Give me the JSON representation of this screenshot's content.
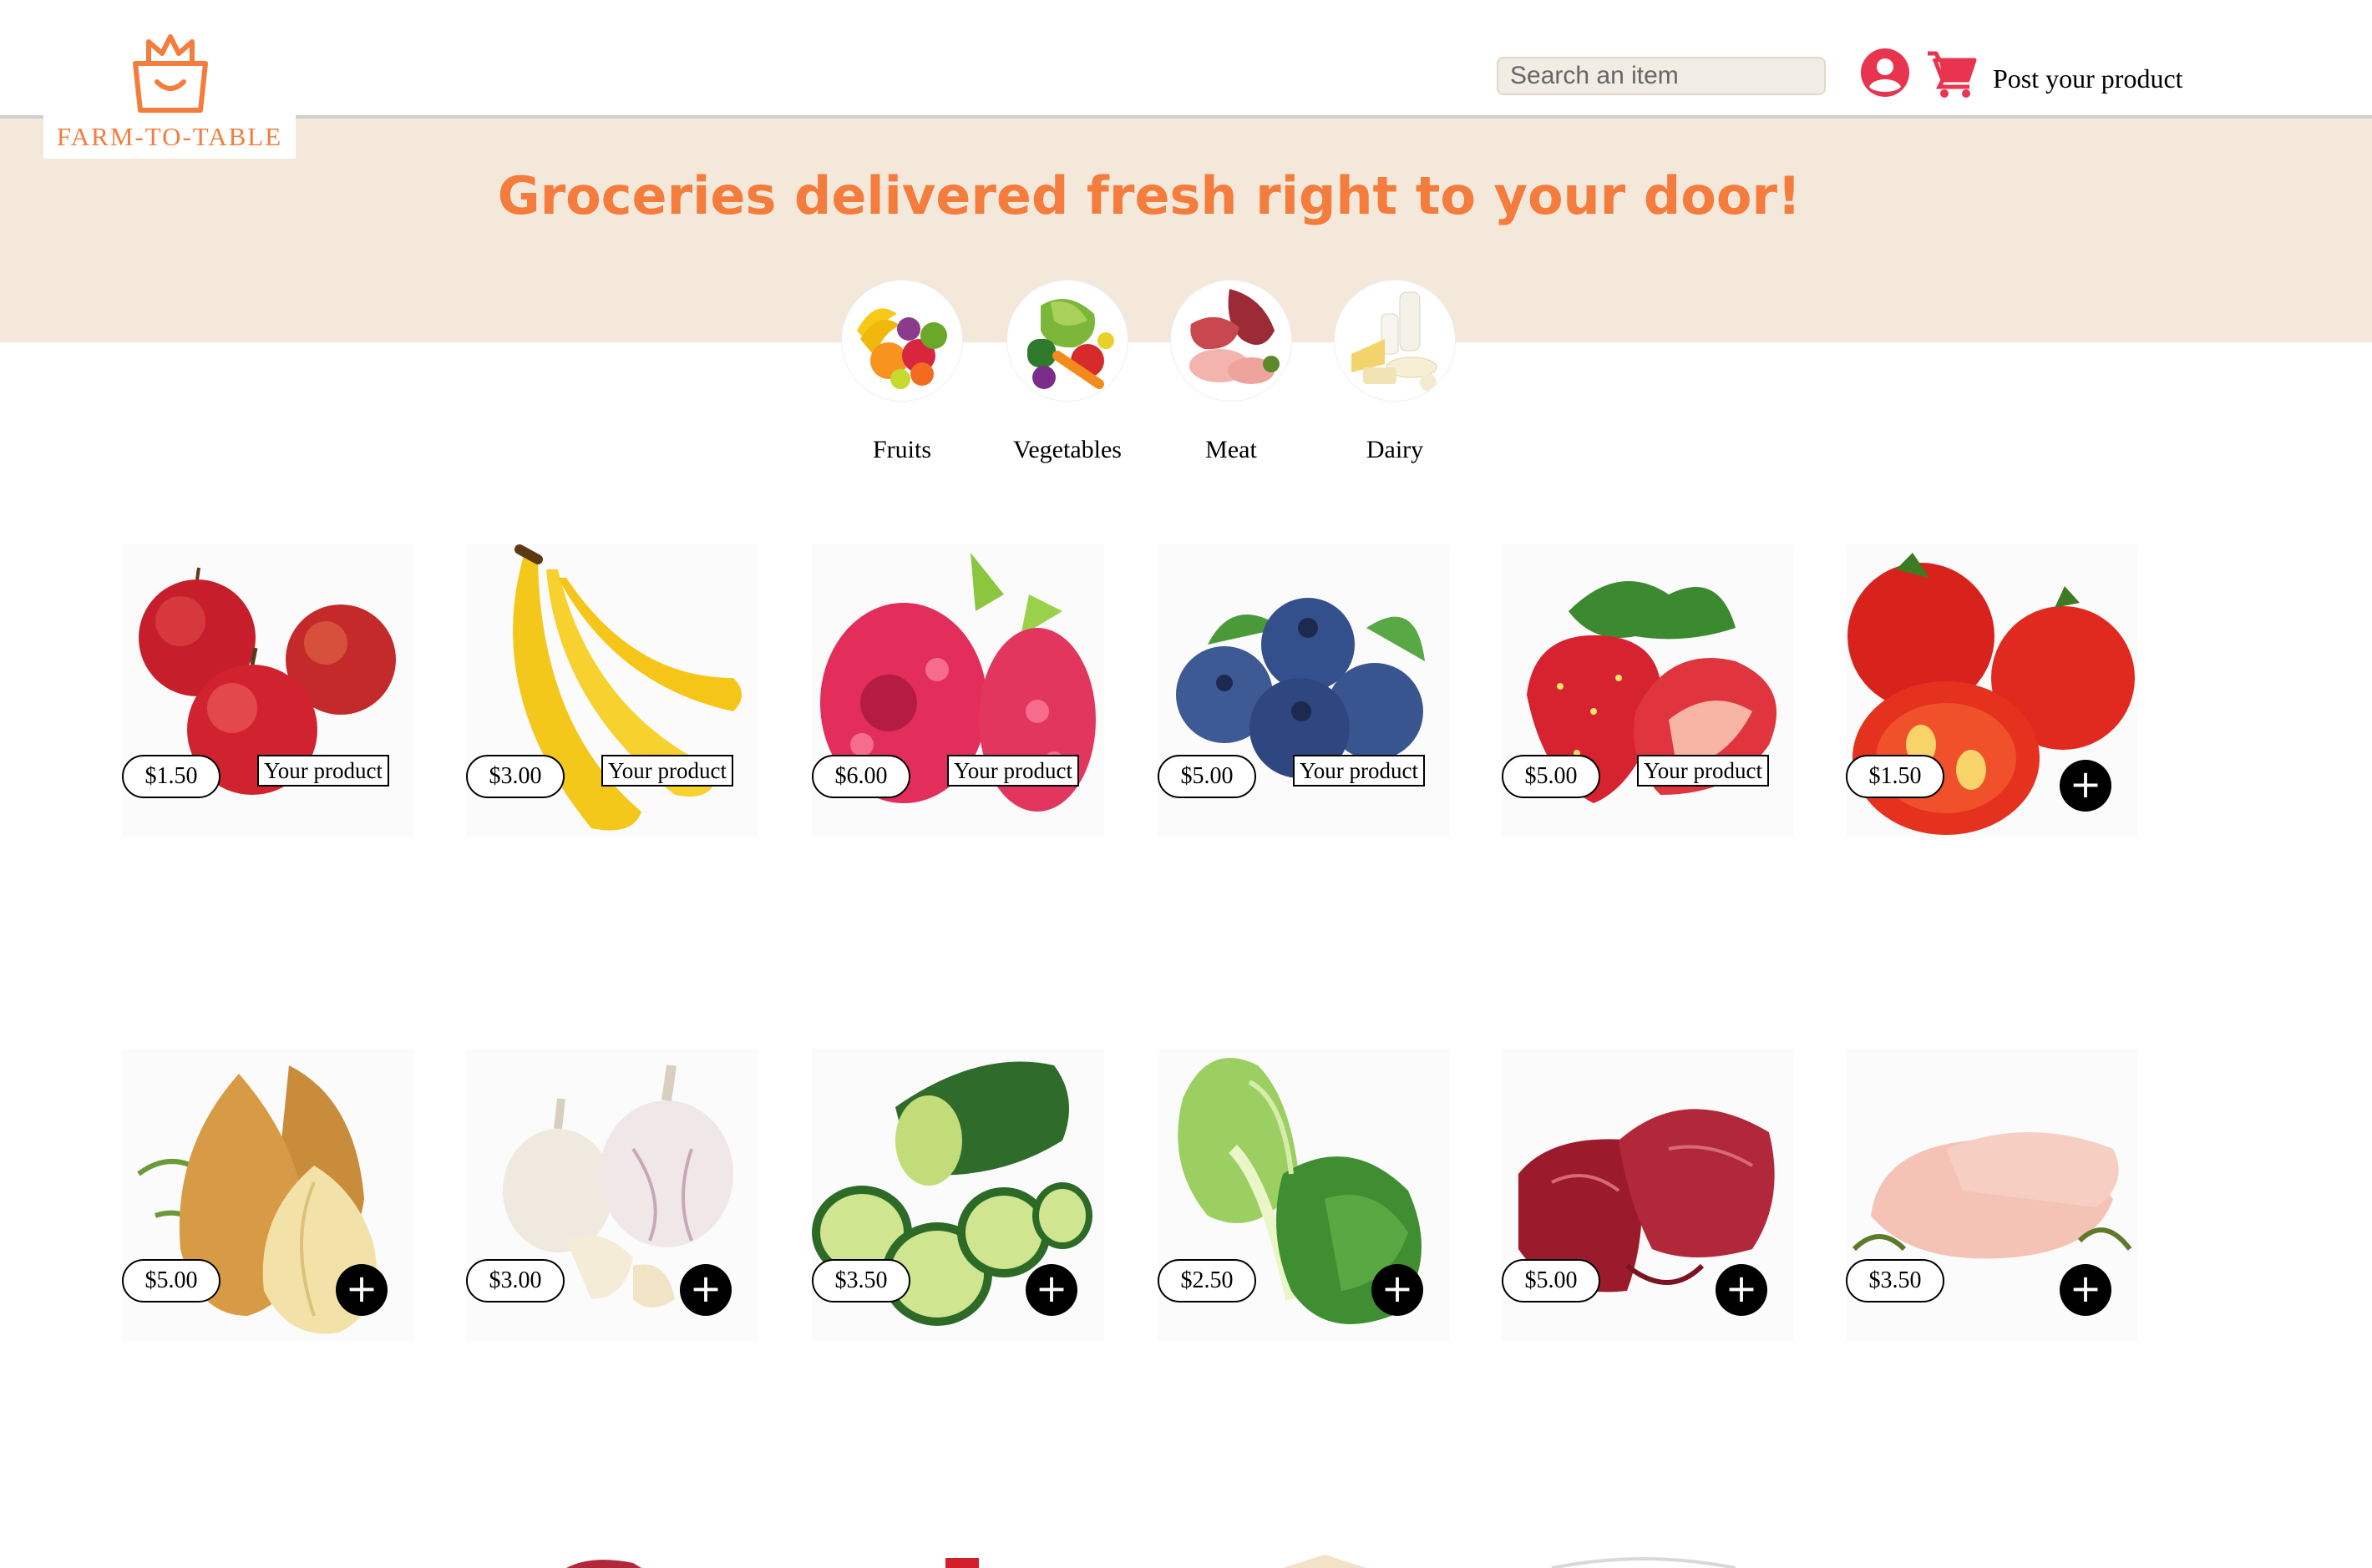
{
  "brand": {
    "name": "FARM-TO-TABLE",
    "color": "#f47c3c"
  },
  "search": {
    "placeholder": "Search an item"
  },
  "nav": {
    "post_label": "Post your product",
    "accent": "#e8344e"
  },
  "hero": {
    "title": "Groceries delivered fresh right to your door!",
    "background": "#f3e8da"
  },
  "categories": [
    {
      "label": "Fruits",
      "icon": "fruits-image"
    },
    {
      "label": "Vegetables",
      "icon": "vegetables-image"
    },
    {
      "label": "Meat",
      "icon": "meat-image"
    },
    {
      "label": "Dairy",
      "icon": "dairy-image"
    }
  ],
  "products": [
    {
      "name": "apple",
      "price": "$1.50",
      "badge": "Your product"
    },
    {
      "name": "banana",
      "price": "$3.00",
      "badge": "Your product"
    },
    {
      "name": "raspberry",
      "price": "$6.00",
      "badge": "Your product"
    },
    {
      "name": "blueberry",
      "price": "$5.00",
      "badge": "Your product"
    },
    {
      "name": "strawberry",
      "price": "$5.00",
      "badge": "Your product"
    },
    {
      "name": "tomato",
      "price": "$1.50",
      "add": "+"
    },
    {
      "name": "onion",
      "price": "$5.00",
      "add": "+"
    },
    {
      "name": "garlic",
      "price": "$3.00",
      "add": "+"
    },
    {
      "name": "cucumber",
      "price": "$3.50",
      "add": "+"
    },
    {
      "name": "lettuce",
      "price": "$2.50",
      "add": "+"
    },
    {
      "name": "beef",
      "price": "$5.00",
      "add": "+"
    },
    {
      "name": "chicken-breast",
      "price": "$3.50",
      "add": "+"
    }
  ]
}
